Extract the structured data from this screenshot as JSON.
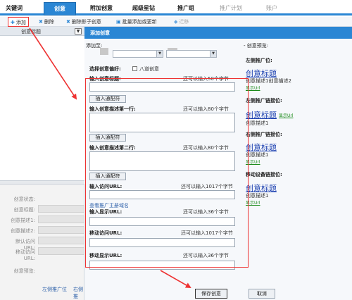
{
  "tabs": [
    {
      "label": "关键词"
    },
    {
      "label": "创意"
    },
    {
      "label": "附加创意"
    },
    {
      "label": "超级星钻"
    },
    {
      "label": "推广组"
    },
    {
      "label": "推广计划"
    },
    {
      "label": "账户"
    }
  ],
  "toolbar": {
    "add": "添加",
    "delete": "删除",
    "delete_shadow": "删除影子创意",
    "batch": "批量添加或更新",
    "move": "迁移"
  },
  "left": {
    "col_header": "创意标题",
    "fields": [
      "创意状态:",
      "创意标题:",
      "创意描述1:",
      "创意描述2:",
      "默认访问URL:",
      "移动访问URL:"
    ],
    "preview_label": "创意预览:",
    "positions": [
      "左侧推广位",
      "右侧推"
    ]
  },
  "dialog": {
    "title": "添加创意",
    "add_to": "添加至:",
    "preference": "选择创意偏好:",
    "pref_option": "八道创意",
    "title_label": "输入创意标题:",
    "title_hint": "还可以输入50个字节",
    "insert_btn": "插入通配符",
    "desc1_label": "输入创意描述第一行:",
    "desc1_hint": "还可以输入80个字节",
    "desc2_label": "输入创意描述第二行:",
    "desc2_hint": "还可以输入80个字节",
    "visit_url_label": "输入访问URL:",
    "visit_url_hint": "还可以输入1017个字节",
    "domain_link": "查看推广主册域名",
    "display_url_label": "输入显示URL:",
    "display_url_hint": "还可以输入36个字节",
    "m_visit_label": "移动访问URL:",
    "m_visit_hint": "还可以输入1017个字节",
    "m_display_label": "移动显示URL:",
    "m_display_hint": "还可以输入36个字节",
    "save": "保存创意",
    "cancel": "取消"
  },
  "preview": {
    "heading": "- 创意预览:",
    "left_pos": "左侧推广位:",
    "title": "创意标题",
    "desc12": "创意描述1创意描述2",
    "url": "显示Url",
    "left_link_pos": "左侧推广链接位:",
    "desc1": "创意描述1",
    "right_link_pos": "右侧推广链接位:",
    "mobile_link_pos": "移动设备链接位:"
  },
  "colors": {
    "accent": "#2a86d4",
    "highlight": "#e33333",
    "link": "#1a3fb0",
    "url": "#1a8a1a"
  }
}
